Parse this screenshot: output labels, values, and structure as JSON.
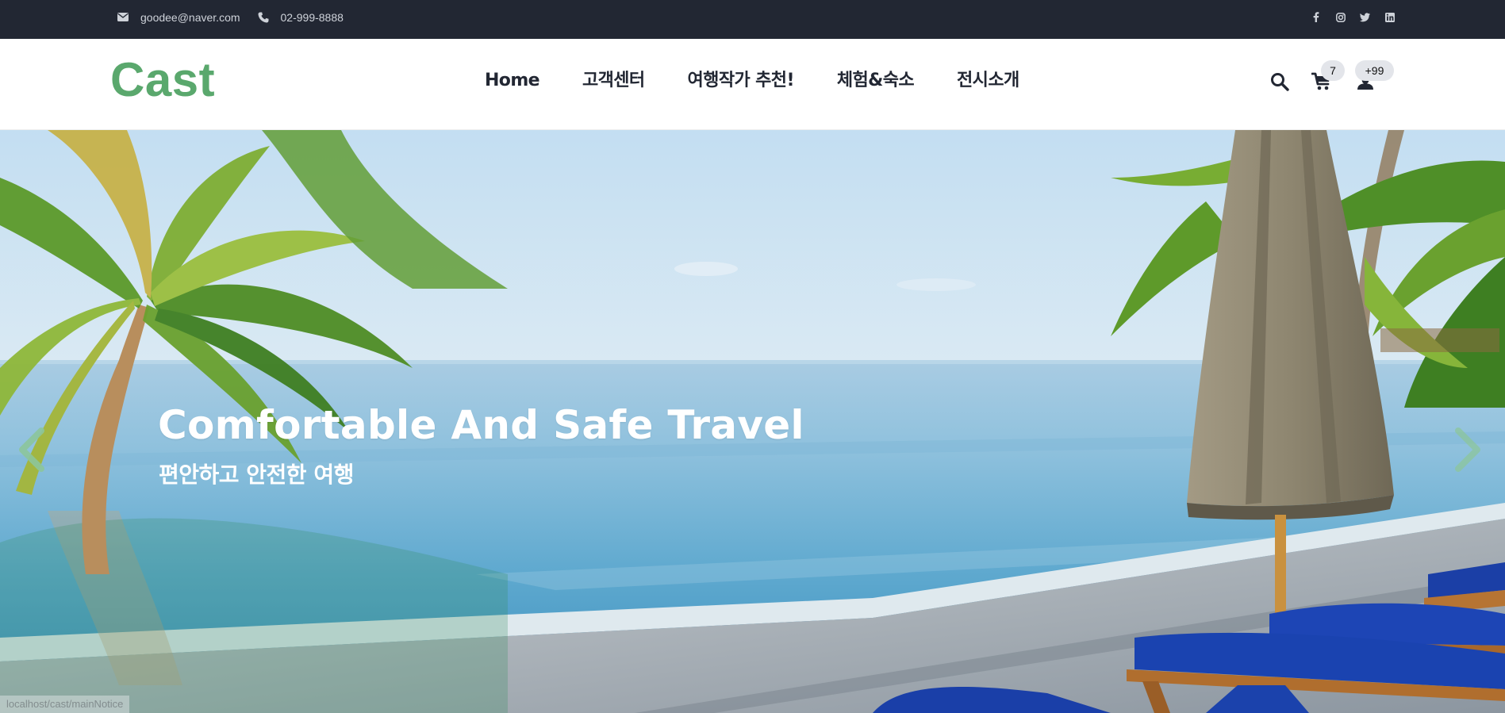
{
  "topbar": {
    "email": "goodee@naver.com",
    "phone": "02-999-8888",
    "social": [
      "facebook-icon",
      "instagram-icon",
      "twitter-icon",
      "linkedin-icon"
    ]
  },
  "header": {
    "logo": "Cast",
    "nav": [
      "Home",
      "고객센터",
      "여행작가 추천!",
      "체험&숙소",
      "전시소개"
    ],
    "cart_count": "7",
    "user_count": "+99"
  },
  "hero": {
    "title": "Comfortable And Safe Travel",
    "subtitle": "편안하고 안전한 여행",
    "prev_icon": "chevron-left-icon",
    "next_icon": "chevron-right-icon"
  },
  "status_bar": {
    "url": "localhost/cast/mainNotice"
  },
  "colors": {
    "topbar_bg": "#222733",
    "brand_green": "#5aa86d",
    "nav_text": "#222733",
    "badge_bg": "#e3e5ea"
  }
}
